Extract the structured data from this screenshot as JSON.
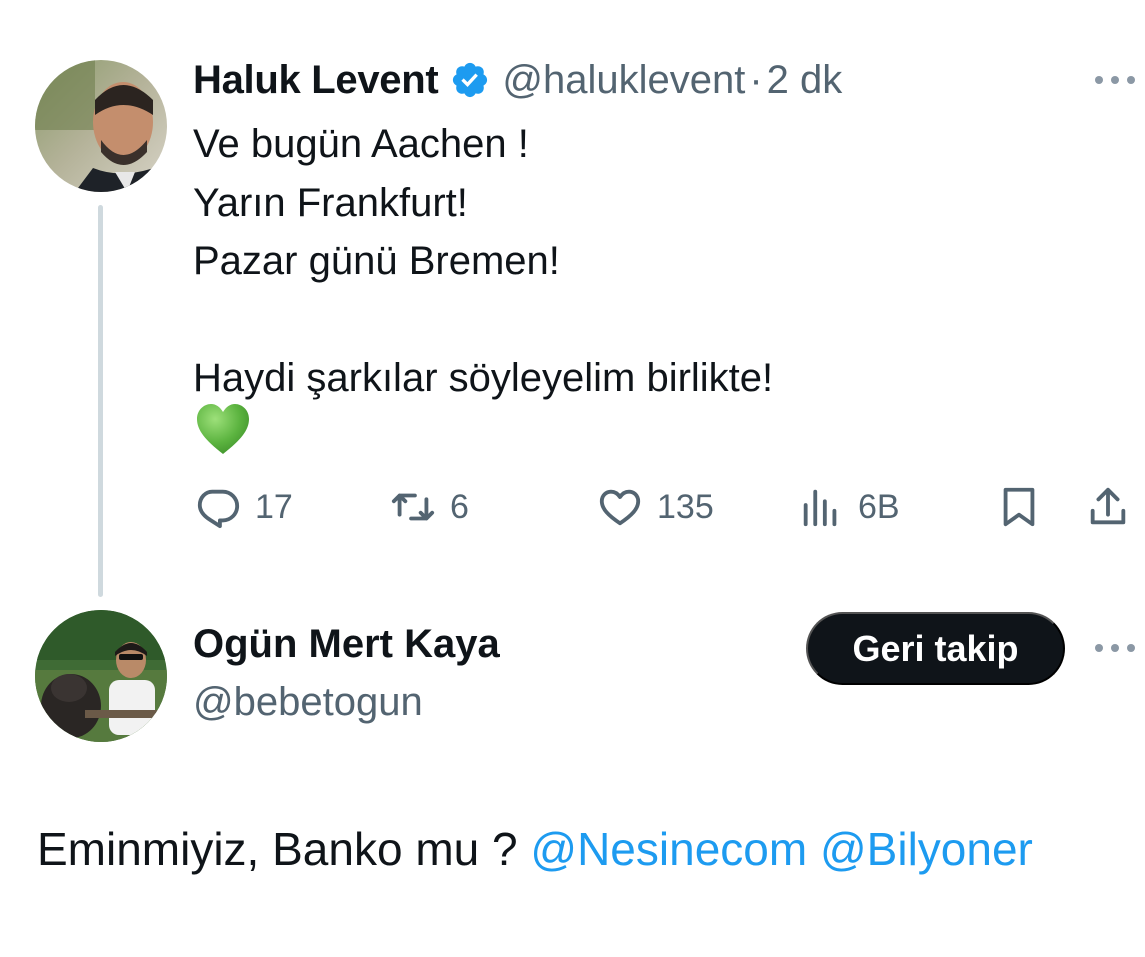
{
  "tweet": {
    "author_name": "Haluk Levent",
    "author_handle": "@haluklevent",
    "separator": "·",
    "time": "2 dk",
    "lines": [
      "Ve bugün Aachen !",
      "Yarın Frankfurt!",
      "Pazar günü Bremen!",
      "",
      "Haydi şarkılar söyleyelim birlikte!"
    ],
    "emoji_icon": "green-heart-icon",
    "actions": {
      "reply_count": "17",
      "retweet_count": "6",
      "like_count": "135",
      "views_count": "6B"
    }
  },
  "reply": {
    "author_name": "Ogün Mert Kaya",
    "author_handle": "@bebetogun",
    "follow_label": "Geri takip",
    "text": "Eminmiyiz, Banko mu ? ",
    "mentions": [
      "@Nesinecom",
      "@Bilyoner"
    ]
  },
  "colors": {
    "accent": "#1d9bf0",
    "text": "#0f1419",
    "secondary": "#536471",
    "heart": "#5bb33f"
  }
}
